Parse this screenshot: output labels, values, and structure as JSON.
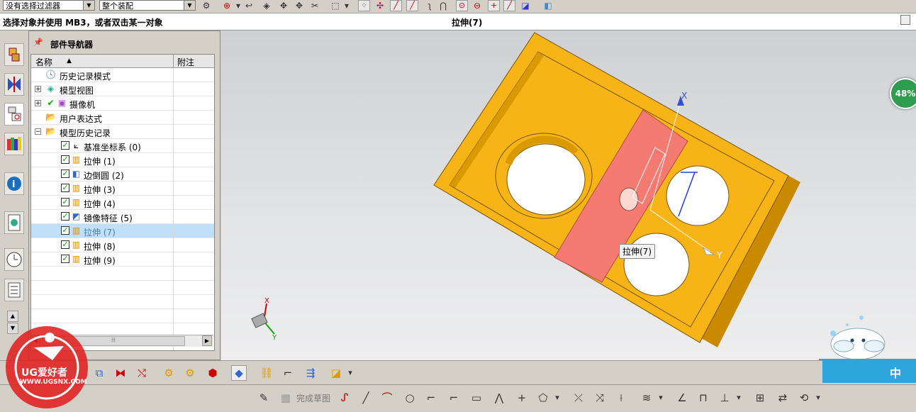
{
  "top_toolbar": {
    "filter_combo": "没有选择过滤器",
    "scope_combo": "整个装配"
  },
  "status": {
    "prompt": "选择对象并使用 MB3，或者双击某一对象",
    "selection": "拉伸(7)"
  },
  "navigator": {
    "title": "部件导航器",
    "col_name": "名称",
    "col_note": "附注",
    "rows": [
      {
        "label": "历史记录模式"
      },
      {
        "label": "模型视图"
      },
      {
        "label": "摄像机"
      },
      {
        "label": "用户表达式"
      },
      {
        "label": "模型历史记录"
      },
      {
        "label": "基准坐标系 (0)"
      },
      {
        "label": "拉伸 (1)"
      },
      {
        "label": "边倒圆 (2)"
      },
      {
        "label": "拉伸 (3)"
      },
      {
        "label": "拉伸 (4)"
      },
      {
        "label": "镜像特征 (5)"
      },
      {
        "label": "拉伸 (7)"
      },
      {
        "label": "拉伸 (8)"
      },
      {
        "label": "拉伸 (9)"
      }
    ]
  },
  "viewport": {
    "tooltip": "拉伸(7)",
    "axis_x": "X",
    "axis_y": "Y",
    "triad_x": "X",
    "triad_y": "Y",
    "progress_percent": "48%"
  },
  "bottom_toolbar": {
    "finish_sketch": "完成草图"
  },
  "logo": {
    "name": "UG爱好者",
    "url": "WWW.UGSNX.COM"
  },
  "mascot": {
    "text": "中"
  },
  "colors": {
    "part": "#f7b417",
    "part_dark": "#c98a00",
    "highlight": "#f47a72",
    "selection": "#bfe0f8",
    "badge": "#2e9d4d"
  }
}
